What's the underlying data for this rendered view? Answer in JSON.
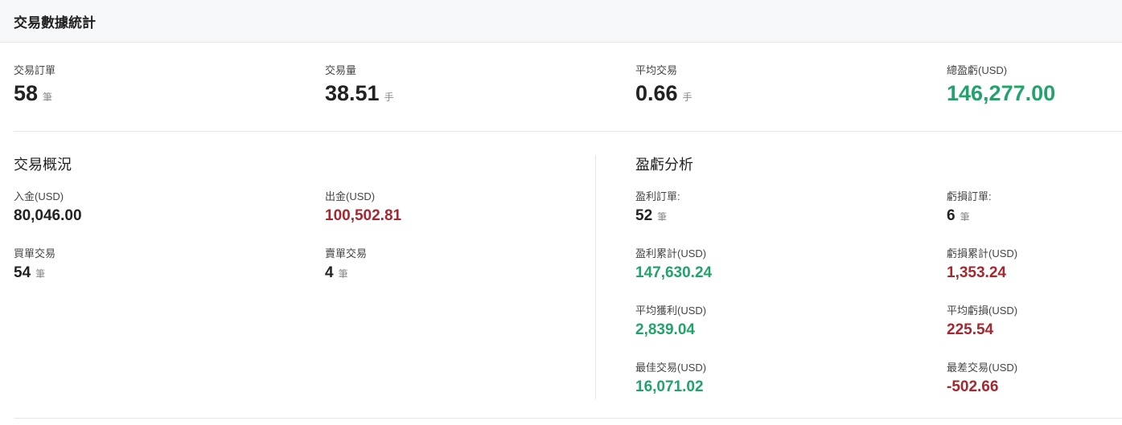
{
  "header": {
    "title": "交易數據統計"
  },
  "summary": {
    "orders": {
      "label": "交易訂單",
      "value": "58",
      "unit": "筆"
    },
    "volume": {
      "label": "交易量",
      "value": "38.51",
      "unit": "手"
    },
    "average": {
      "label": "平均交易",
      "value": "0.66",
      "unit": "手"
    },
    "total_pnl": {
      "label": "總盈虧(USD)",
      "value": "146,277.00"
    }
  },
  "overview": {
    "title": "交易概況",
    "deposit": {
      "label": "入金(USD)",
      "value": "80,046.00"
    },
    "withdrawal": {
      "label": "出金(USD)",
      "value": "100,502.81"
    },
    "buy_trades": {
      "label": "買單交易",
      "value": "54",
      "unit": "筆"
    },
    "sell_trades": {
      "label": "賣單交易",
      "value": "4",
      "unit": "筆"
    }
  },
  "pnl_analysis": {
    "title": "盈虧分析",
    "profit_orders": {
      "label": "盈利訂單:",
      "value": "52",
      "unit": "筆"
    },
    "loss_orders": {
      "label": "虧損訂單:",
      "value": "6",
      "unit": "筆"
    },
    "profit_total": {
      "label": "盈利累計(USD)",
      "value": "147,630.24"
    },
    "loss_total": {
      "label": "虧損累計(USD)",
      "value": "1,353.24"
    },
    "avg_profit": {
      "label": "平均獲利(USD)",
      "value": "2,839.04"
    },
    "avg_loss": {
      "label": "平均虧損(USD)",
      "value": "225.54"
    },
    "best_trade": {
      "label": "最佳交易(USD)",
      "value": "16,071.02"
    },
    "worst_trade": {
      "label": "最差交易(USD)",
      "value": "-502.66"
    }
  },
  "colors": {
    "positive": "#22a36b",
    "negative": "#a52830",
    "text": "#222222"
  }
}
